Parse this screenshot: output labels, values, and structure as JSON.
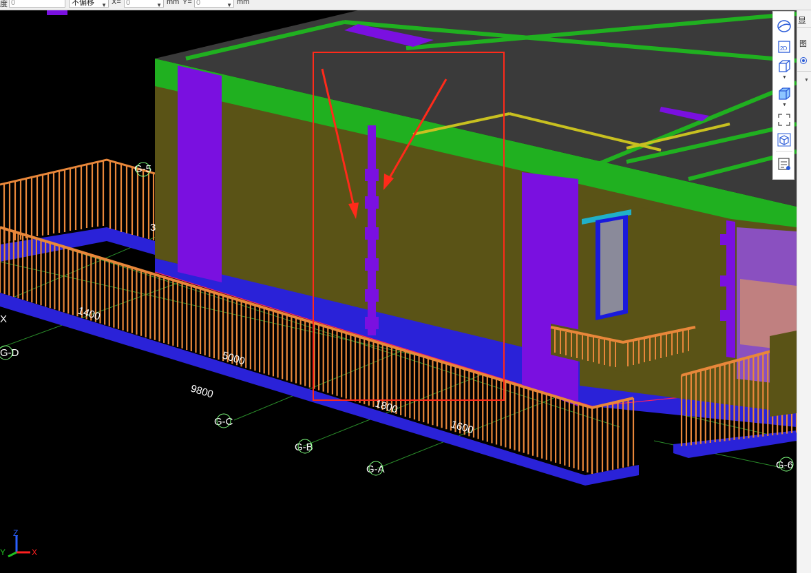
{
  "toolbar_top": {
    "angle_label": "度",
    "angle_value": "0",
    "offset_mode": "不偏移",
    "x_label": "X=",
    "x_value": "0",
    "x_unit": "mm",
    "y_label": "Y=",
    "y_value": "0",
    "y_unit": "mm"
  },
  "viewport": {
    "grid_labels": {
      "g5": "G-5",
      "gd": "G-D",
      "gc": "G-C",
      "gb": "G-B",
      "ga": "G-A",
      "g6": "G-6",
      "g3": "3",
      "gx": "X"
    },
    "dimensions": {
      "d1400": "1400",
      "d5000": "5000",
      "d9800": "9800",
      "d1800": "1800",
      "d1600": "1600"
    },
    "axes": {
      "z": "Z",
      "y": "Y",
      "x": "X"
    }
  },
  "right_panel": {
    "tab_top": "显",
    "tab_second": "图"
  },
  "colors": {
    "wall": "#5a5316",
    "slab": "#3a3a3a",
    "beam": "#20b020",
    "column": "#7a10e0",
    "railing": "#e8873a",
    "base": "#2a22d8",
    "annotation": "#ff2a1a",
    "grid": "#2a8c2a"
  },
  "icons": [
    "orbit-icon",
    "2d-view-icon",
    "3d-box-icon",
    "solid-box-icon",
    "fullscreen-icon",
    "cube-outline-icon",
    "properties-list-icon"
  ]
}
